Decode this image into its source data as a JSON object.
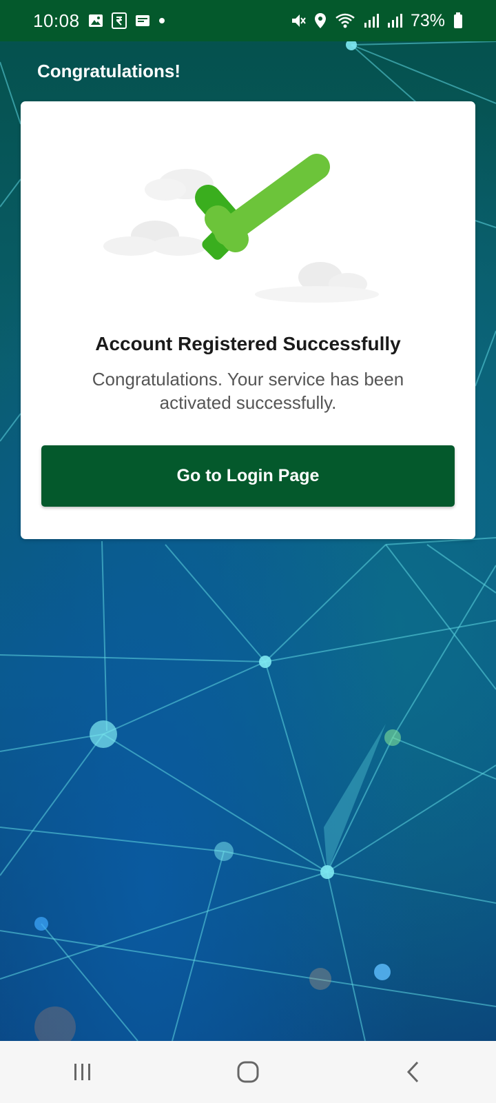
{
  "status_bar": {
    "time": "10:08",
    "battery": "73%",
    "icons": [
      "image-icon",
      "rupee-icon",
      "news-icon",
      "dot-icon",
      "mute-icon",
      "location-icon",
      "wifi-icon",
      "signal-icon",
      "signal-icon",
      "battery-icon"
    ]
  },
  "header": {
    "title": "Congratulations!"
  },
  "card": {
    "illustration": "checkmark-icon",
    "heading": "Account Registered Successfully",
    "message": "Congratulations. Your service has been activated successfully.",
    "button_label": "Go to Login Page"
  },
  "nav": {
    "icons": [
      "recents-icon",
      "home-icon",
      "back-icon"
    ]
  },
  "colors": {
    "primary": "#04592c",
    "check_dark": "#3aae1e",
    "check_light": "#6cc43a"
  }
}
